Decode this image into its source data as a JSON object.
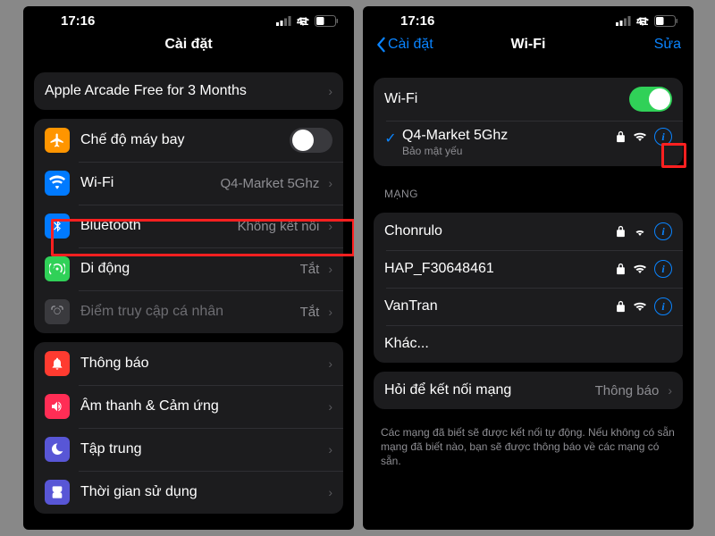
{
  "status": {
    "time": "17:16",
    "battery": "41"
  },
  "left": {
    "title": "Cài đặt",
    "promo": "Apple Arcade Free for 3 Months",
    "rows": {
      "airplane": "Chế độ máy bay",
      "wifi": "Wi-Fi",
      "wifi_value": "Q4-Market 5Ghz",
      "bluetooth": "Bluetooth",
      "bluetooth_value": "Không kết nối",
      "cellular": "Di động",
      "cellular_value": "Tắt",
      "hotspot": "Điểm truy cập cá nhân",
      "hotspot_value": "Tắt",
      "notifications": "Thông báo",
      "sounds": "Âm thanh & Cảm ứng",
      "focus": "Tập trung",
      "screentime": "Thời gian sử dụng"
    }
  },
  "right": {
    "back": "Cài đặt",
    "title": "Wi-Fi",
    "edit": "Sửa",
    "wifi_label": "Wi-Fi",
    "current": {
      "name": "Q4-Market 5Ghz",
      "security": "Bảo mật yếu"
    },
    "networks_header": "MẠNG",
    "networks": [
      "Chonrulo",
      "HAP_F30648461",
      "VanTran"
    ],
    "other": "Khác...",
    "ask_label": "Hỏi để kết nối mạng",
    "ask_value": "Thông báo",
    "footer": "Các mạng đã biết sẽ được kết nối tự động. Nếu không có sẵn mạng đã biết nào, bạn sẽ được thông báo về các mạng có sẵn."
  }
}
